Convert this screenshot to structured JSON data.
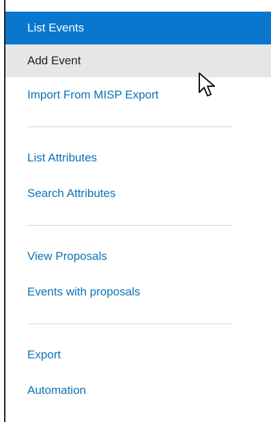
{
  "menu": {
    "items": [
      {
        "label": "List Events"
      },
      {
        "label": "Add Event"
      },
      {
        "label": "Import From MISP Export"
      },
      {
        "label": "List Attributes"
      },
      {
        "label": "Search Attributes"
      },
      {
        "label": "View Proposals"
      },
      {
        "label": "Events with proposals"
      },
      {
        "label": "Export"
      },
      {
        "label": "Automation"
      }
    ]
  },
  "colors": {
    "active_bg": "#0a77cf",
    "hover_bg": "#e6e6e6",
    "link": "#0b72b8"
  },
  "cursor_icon": "mouse-pointer-icon"
}
